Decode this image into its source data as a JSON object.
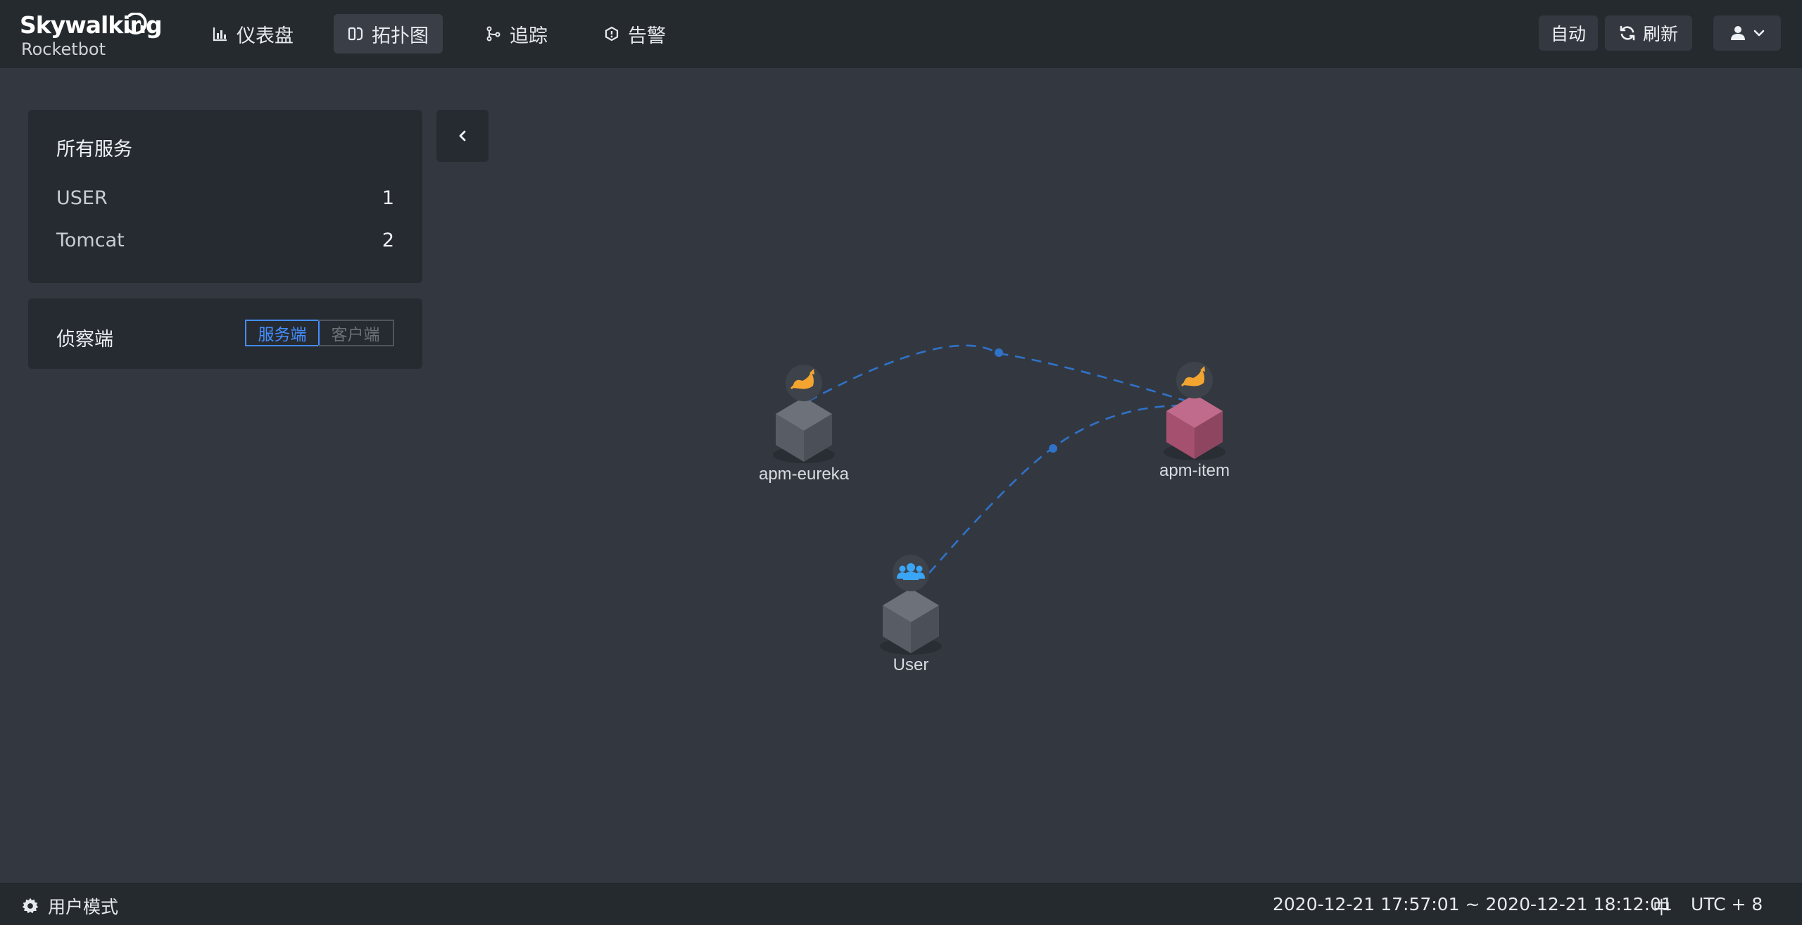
{
  "brand": {
    "name": "Skywalking",
    "sub": "Rocketbot"
  },
  "nav": [
    {
      "label": "仪表盘",
      "icon": "chart-icon",
      "active": false
    },
    {
      "label": "拓扑图",
      "icon": "topology-icon",
      "active": true
    },
    {
      "label": "追踪",
      "icon": "trace-icon",
      "active": false
    },
    {
      "label": "告警",
      "icon": "alarm-icon",
      "active": false
    }
  ],
  "toolbar": {
    "auto_label": "自动",
    "refresh_label": "刷新"
  },
  "services_panel": {
    "title": "所有服务",
    "items": [
      {
        "name": "USER",
        "count": "1"
      },
      {
        "name": "Tomcat",
        "count": "2"
      }
    ]
  },
  "detect_panel": {
    "title": "侦察端",
    "server_label": "服务端",
    "client_label": "客户端",
    "selected": "server"
  },
  "topology": {
    "nodes": [
      {
        "name": "apm-eureka",
        "type": "Tomcat",
        "icon": "tomcat-icon",
        "color": "#5a5f68"
      },
      {
        "name": "apm-item",
        "type": "Tomcat",
        "icon": "tomcat-icon",
        "color": "#a5506e",
        "alert": true
      },
      {
        "name": "User",
        "type": "USER",
        "icon": "users-icon",
        "color": "#5a5f68"
      }
    ],
    "edges": [
      {
        "from": "apm-eureka",
        "to": "apm-item"
      },
      {
        "from": "User",
        "to": "apm-item"
      }
    ],
    "link_color": "#2f72c8",
    "tomcat_icon_color": "#f3a530",
    "user_icon_color": "#3aa5f5"
  },
  "footer": {
    "mode_label": "用户模式",
    "time_range": "2020-12-21 17:57:01 ~ 2020-12-21 18:12:01",
    "lang": "中",
    "timezone": "UTC + 8"
  }
}
